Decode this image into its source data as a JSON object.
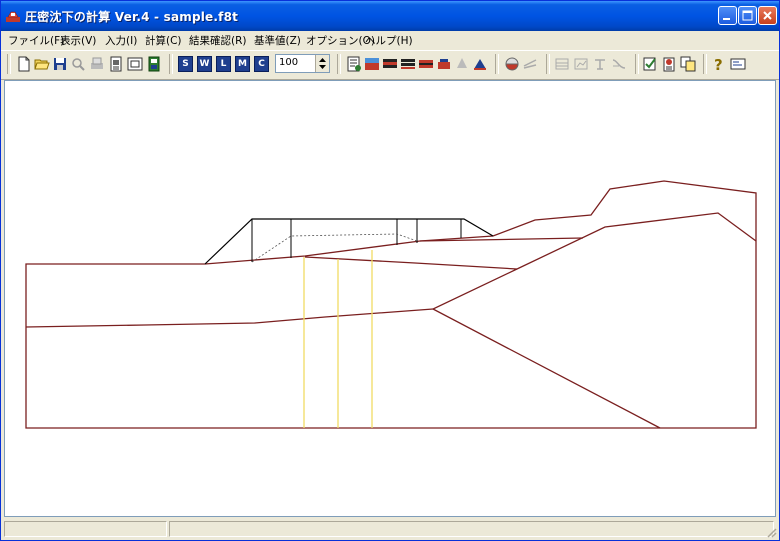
{
  "window": {
    "title": "圧密沈下の計算 Ver.4 - sample.f8t"
  },
  "menu": [
    "ファイル(F)",
    "表示(V)",
    "入力(I)",
    "計算(C)",
    "結果確認(R)",
    "基準値(Z)",
    "オプション(O)",
    "ヘルプ(H)"
  ],
  "toolbar": {
    "letter_buttons": [
      "S",
      "W",
      "L",
      "M",
      "C"
    ],
    "zoom_value": "100"
  },
  "colors": {
    "layer_boundary": "#7a1f1f",
    "embankment": "#000000",
    "analysis_line": "#f0dc64"
  },
  "status": {
    "panel1": "",
    "panel2": ""
  }
}
